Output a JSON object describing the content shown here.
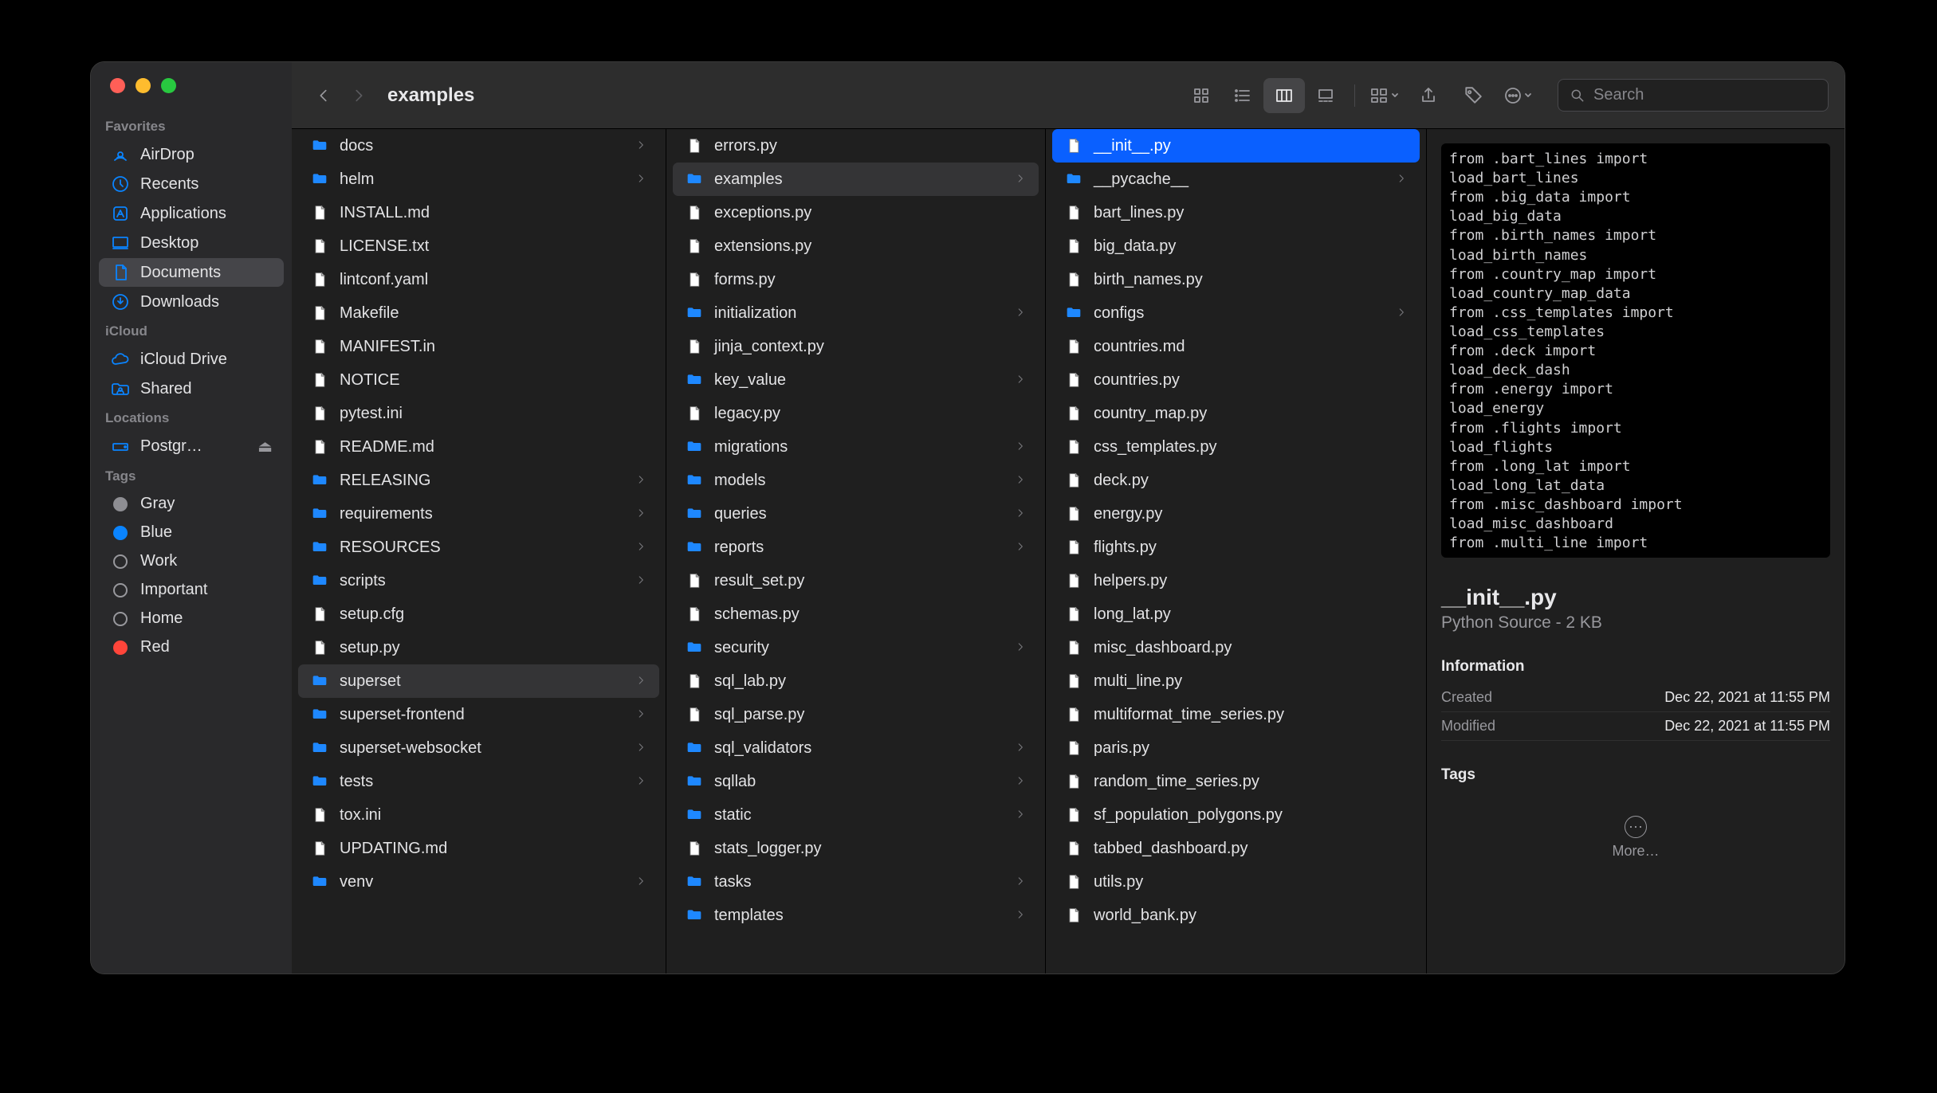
{
  "window": {
    "title": "examples"
  },
  "traffic": [
    "close",
    "minimize",
    "zoom"
  ],
  "sidebar": {
    "sections": [
      {
        "label": "Favorites",
        "items": [
          {
            "icon": "airdrop",
            "label": "AirDrop"
          },
          {
            "icon": "recents",
            "label": "Recents"
          },
          {
            "icon": "applications",
            "label": "Applications"
          },
          {
            "icon": "desktop",
            "label": "Desktop"
          },
          {
            "icon": "documents",
            "label": "Documents",
            "active": true
          },
          {
            "icon": "downloads",
            "label": "Downloads"
          }
        ]
      },
      {
        "label": "iCloud",
        "items": [
          {
            "icon": "icloud",
            "label": "iCloud Drive"
          },
          {
            "icon": "shared",
            "label": "Shared"
          }
        ]
      },
      {
        "label": "Locations",
        "items": [
          {
            "icon": "disk",
            "label": "Postgr…",
            "eject": true
          }
        ]
      },
      {
        "label": "Tags",
        "items": [
          {
            "icon": "tag",
            "label": "Gray",
            "color": "#8e8e93"
          },
          {
            "icon": "tag",
            "label": "Blue",
            "color": "#0a84ff"
          },
          {
            "icon": "tag",
            "label": "Work",
            "color": null
          },
          {
            "icon": "tag",
            "label": "Important",
            "color": null
          },
          {
            "icon": "tag",
            "label": "Home",
            "color": null
          },
          {
            "icon": "tag",
            "label": "Red",
            "color": "#ff453a",
            "partial": true
          }
        ]
      }
    ]
  },
  "toolbar": {
    "views": [
      "icons",
      "list",
      "columns",
      "gallery"
    ],
    "active_view": "columns",
    "search_placeholder": "Search"
  },
  "columns": [
    {
      "scroll": -1,
      "items": [
        {
          "name": "docs",
          "type": "folder"
        },
        {
          "name": "helm",
          "type": "folder"
        },
        {
          "name": "INSTALL.md",
          "type": "file"
        },
        {
          "name": "LICENSE.txt",
          "type": "file"
        },
        {
          "name": "lintconf.yaml",
          "type": "file"
        },
        {
          "name": "Makefile",
          "type": "file"
        },
        {
          "name": "MANIFEST.in",
          "type": "file"
        },
        {
          "name": "NOTICE",
          "type": "file"
        },
        {
          "name": "pytest.ini",
          "type": "file"
        },
        {
          "name": "README.md",
          "type": "file"
        },
        {
          "name": "RELEASING",
          "type": "folder"
        },
        {
          "name": "requirements",
          "type": "folder"
        },
        {
          "name": "RESOURCES",
          "type": "folder"
        },
        {
          "name": "scripts",
          "type": "folder"
        },
        {
          "name": "setup.cfg",
          "type": "file"
        },
        {
          "name": "setup.py",
          "type": "file"
        },
        {
          "name": "superset",
          "type": "folder",
          "path": true
        },
        {
          "name": "superset-frontend",
          "type": "folder"
        },
        {
          "name": "superset-websocket",
          "type": "folder"
        },
        {
          "name": "tests",
          "type": "folder"
        },
        {
          "name": "tox.ini",
          "type": "file"
        },
        {
          "name": "UPDATING.md",
          "type": "file"
        },
        {
          "name": "venv",
          "type": "folder"
        }
      ]
    },
    {
      "scroll": -1,
      "items": [
        {
          "name": "errors.py",
          "type": "file"
        },
        {
          "name": "examples",
          "type": "folder",
          "path": true
        },
        {
          "name": "exceptions.py",
          "type": "file"
        },
        {
          "name": "extensions.py",
          "type": "file"
        },
        {
          "name": "forms.py",
          "type": "file"
        },
        {
          "name": "initialization",
          "type": "folder"
        },
        {
          "name": "jinja_context.py",
          "type": "file"
        },
        {
          "name": "key_value",
          "type": "folder"
        },
        {
          "name": "legacy.py",
          "type": "file"
        },
        {
          "name": "migrations",
          "type": "folder"
        },
        {
          "name": "models",
          "type": "folder"
        },
        {
          "name": "queries",
          "type": "folder"
        },
        {
          "name": "reports",
          "type": "folder"
        },
        {
          "name": "result_set.py",
          "type": "file"
        },
        {
          "name": "schemas.py",
          "type": "file"
        },
        {
          "name": "security",
          "type": "folder"
        },
        {
          "name": "sql_lab.py",
          "type": "file"
        },
        {
          "name": "sql_parse.py",
          "type": "file"
        },
        {
          "name": "sql_validators",
          "type": "folder"
        },
        {
          "name": "sqllab",
          "type": "folder"
        },
        {
          "name": "static",
          "type": "folder"
        },
        {
          "name": "stats_logger.py",
          "type": "file"
        },
        {
          "name": "tasks",
          "type": "folder"
        },
        {
          "name": "templates",
          "type": "folder"
        }
      ]
    },
    {
      "items": [
        {
          "name": "__init__.py",
          "type": "file",
          "selected": true
        },
        {
          "name": "__pycache__",
          "type": "folder"
        },
        {
          "name": "bart_lines.py",
          "type": "file"
        },
        {
          "name": "big_data.py",
          "type": "file"
        },
        {
          "name": "birth_names.py",
          "type": "file"
        },
        {
          "name": "configs",
          "type": "folder"
        },
        {
          "name": "countries.md",
          "type": "file"
        },
        {
          "name": "countries.py",
          "type": "file"
        },
        {
          "name": "country_map.py",
          "type": "file"
        },
        {
          "name": "css_templates.py",
          "type": "file"
        },
        {
          "name": "deck.py",
          "type": "file"
        },
        {
          "name": "energy.py",
          "type": "file"
        },
        {
          "name": "flights.py",
          "type": "file"
        },
        {
          "name": "helpers.py",
          "type": "file"
        },
        {
          "name": "long_lat.py",
          "type": "file"
        },
        {
          "name": "misc_dashboard.py",
          "type": "file"
        },
        {
          "name": "multi_line.py",
          "type": "file"
        },
        {
          "name": "multiformat_time_series.py",
          "type": "file"
        },
        {
          "name": "paris.py",
          "type": "file"
        },
        {
          "name": "random_time_series.py",
          "type": "file"
        },
        {
          "name": "sf_population_polygons.py",
          "type": "file"
        },
        {
          "name": "tabbed_dashboard.py",
          "type": "file"
        },
        {
          "name": "utils.py",
          "type": "file"
        },
        {
          "name": "world_bank.py",
          "type": "file"
        }
      ]
    }
  ],
  "preview": {
    "code": "from .bart_lines import\nload_bart_lines\nfrom .big_data import\nload_big_data\nfrom .birth_names import\nload_birth_names\nfrom .country_map import\nload_country_map_data\nfrom .css_templates import\nload_css_templates\nfrom .deck import\nload_deck_dash\nfrom .energy import\nload_energy\nfrom .flights import\nload_flights\nfrom .long_lat import\nload_long_lat_data\nfrom .misc_dashboard import\nload_misc_dashboard\nfrom .multi_line import",
    "filename": "__init__.py",
    "kind": "Python Source - 2 KB",
    "info_label": "Information",
    "created_label": "Created",
    "created": "Dec 22, 2021 at 11:55 PM",
    "modified_label": "Modified",
    "modified": "Dec 22, 2021 at 11:55 PM",
    "tags_label": "Tags",
    "more_label": "More…"
  }
}
